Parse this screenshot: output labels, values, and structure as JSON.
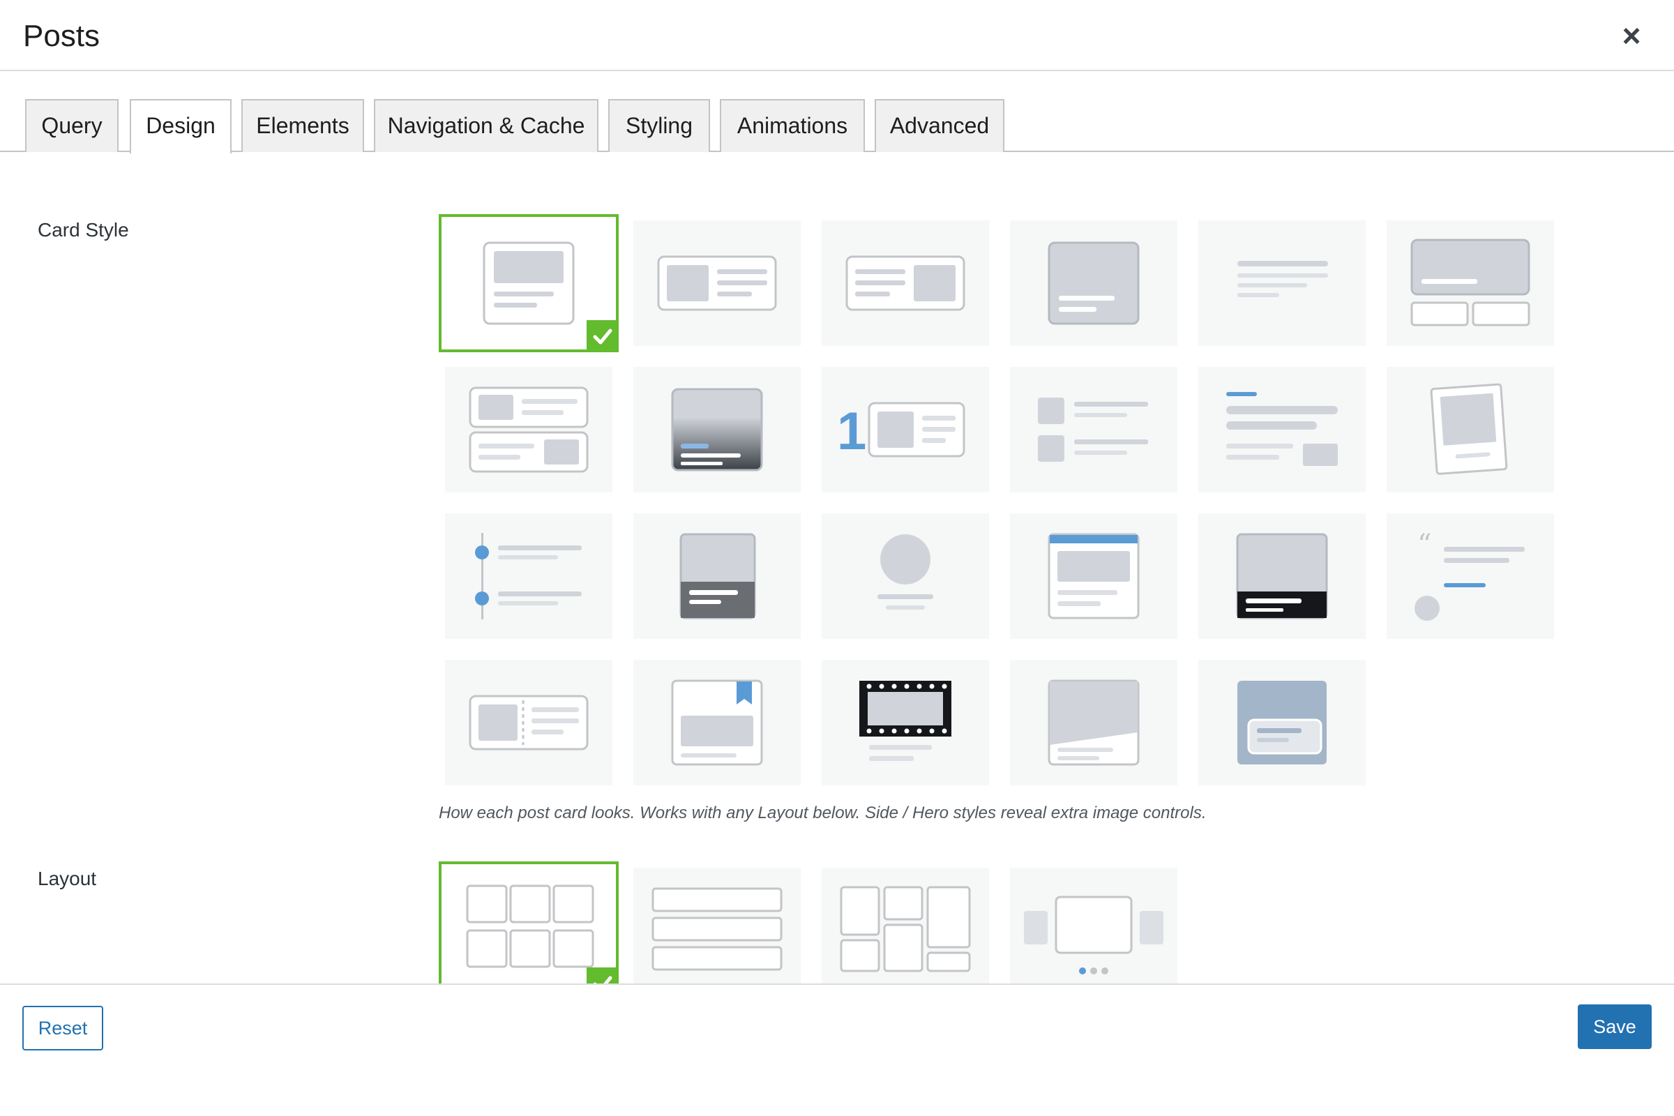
{
  "dialog": {
    "title": "Posts",
    "close_icon": "close-icon"
  },
  "tabs": [
    {
      "label": "Query",
      "active": false
    },
    {
      "label": "Design",
      "active": true
    },
    {
      "label": "Elements",
      "active": false
    },
    {
      "label": "Navigation & Cache",
      "active": false
    },
    {
      "label": "Styling",
      "active": false
    },
    {
      "label": "Animations",
      "active": false
    },
    {
      "label": "Advanced",
      "active": false
    }
  ],
  "card_style": {
    "label": "Card Style",
    "hint": "How each post card looks. Works with any Layout below. Side / Hero styles reveal extra image controls.",
    "selected_index": 0,
    "option_count": 23
  },
  "layout": {
    "label": "Layout",
    "selected_index": 0,
    "option_count": 4
  },
  "footer": {
    "reset_label": "Reset",
    "save_label": "Save"
  },
  "colors": {
    "accent": "#2271b1",
    "selected": "#63bb2e",
    "tile_bg": "#f6f7f7",
    "placeholder": "#d0d4da",
    "outline": "#c3c4c7"
  }
}
